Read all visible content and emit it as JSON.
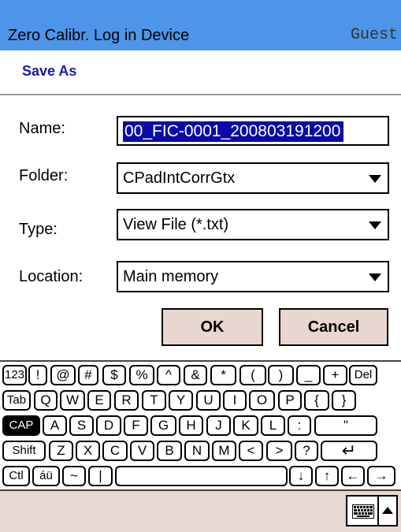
{
  "titlebar": {
    "title": "Zero Calibr. Log in Device",
    "user": "Guest"
  },
  "dialog": {
    "title": "Save As"
  },
  "form": {
    "name_label": "Name:",
    "name_value": "00_FIC-0001_200803191200",
    "folder_label": "Folder:",
    "folder_value": "CPadIntCorrGtx",
    "type_label": "Type:",
    "type_value": "View File (*.txt)",
    "location_label": "Location:",
    "location_value": "Main memory"
  },
  "buttons": {
    "ok": "OK",
    "cancel": "Cancel"
  },
  "keyboard": {
    "row1": [
      "123",
      "!",
      "@",
      "#",
      "$",
      "%",
      "^",
      "&",
      "*",
      "(",
      ")",
      "_",
      "+",
      "Del"
    ],
    "row2": [
      "Tab",
      "Q",
      "W",
      "E",
      "R",
      "T",
      "Y",
      "U",
      "I",
      "O",
      "P",
      "{",
      "}"
    ],
    "row3": [
      "CAP",
      "A",
      "S",
      "D",
      "F",
      "G",
      "H",
      "J",
      "K",
      "L",
      ":",
      "\""
    ],
    "row4": [
      "Shift",
      "Z",
      "X",
      "C",
      "V",
      "B",
      "N",
      "M",
      "<",
      ">",
      "?",
      "↵"
    ],
    "row5": [
      "Ctl",
      "áü",
      "~",
      "|",
      "",
      "↓",
      "↑",
      "←",
      "→"
    ]
  },
  "colors": {
    "titlebar": "#4d95e8",
    "dialog_title": "#1a1aa6",
    "selection": "#0a0aa8",
    "button_bg": "#e8d7d0",
    "bottombar": "#e6d8d2"
  }
}
